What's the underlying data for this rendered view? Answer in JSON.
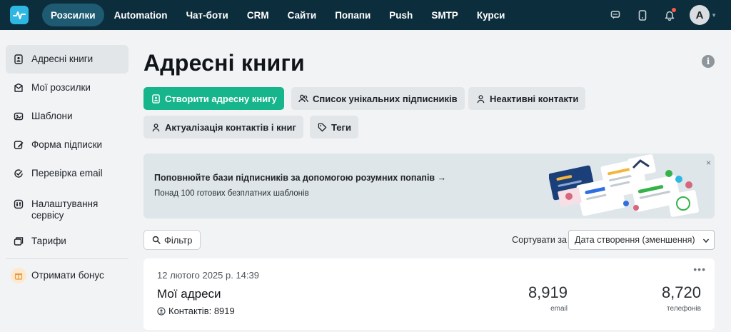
{
  "nav": {
    "items": [
      {
        "label": "Розсилки",
        "active": true
      },
      {
        "label": "Automation",
        "active": false
      },
      {
        "label": "Чат-боти",
        "active": false
      },
      {
        "label": "CRM",
        "active": false
      },
      {
        "label": "Сайти",
        "active": false
      },
      {
        "label": "Попапи",
        "active": false
      },
      {
        "label": "Push",
        "active": false
      },
      {
        "label": "SMTP",
        "active": false
      },
      {
        "label": "Курси",
        "active": false
      }
    ],
    "avatar_letter": "A",
    "icons": [
      "chat-icon",
      "mobile-icon",
      "bell-icon"
    ]
  },
  "sidebar": {
    "items": [
      {
        "label": "Адресні книги",
        "icon": "address-book-icon",
        "active": true
      },
      {
        "label": "Мої розсилки",
        "icon": "campaigns-icon",
        "active": false
      },
      {
        "label": "Шаблони",
        "icon": "templates-icon",
        "active": false
      },
      {
        "label": "Форма підписки",
        "icon": "form-icon",
        "active": false
      },
      {
        "label": "Перевірка email",
        "icon": "check-icon",
        "active": false
      },
      {
        "label": "Налаштування сервісу",
        "icon": "settings-icon",
        "active": false
      },
      {
        "label": "Тарифи",
        "icon": "tariffs-icon",
        "active": false
      }
    ],
    "bonus_label": "Отримати бонус"
  },
  "page": {
    "title": "Адресні книги"
  },
  "actions": {
    "create": "Створити адресну книгу",
    "unique_subscribers": "Список унікальних підписників",
    "inactive_contacts": "Неактивні контакти",
    "actualization": "Актуалізація контактів і книг",
    "tags": "Теги"
  },
  "banner": {
    "title": "Поповнюйте бази підписників за допомогою розумних попапів →",
    "subtitle": "Понад 100 готових безплатних шаблонів",
    "close": "×"
  },
  "filter": {
    "label": "Фільтр",
    "sort_label": "Сортувати за",
    "sort_value": "Дата створення (зменшення)"
  },
  "books": [
    {
      "date": "12 лютого 2025 р. 14:39",
      "name": "Мої адреси",
      "contacts": "Контактів: 8919",
      "email_count": "8,919",
      "email_label": "email",
      "phone_count": "8,720",
      "phone_label": "телефонів",
      "more": "•••"
    }
  ],
  "colors": {
    "nav_bg": "#0c2d3c",
    "nav_active": "#1e5a71",
    "primary": "#16b58b",
    "logo": "#2fb7e3"
  }
}
